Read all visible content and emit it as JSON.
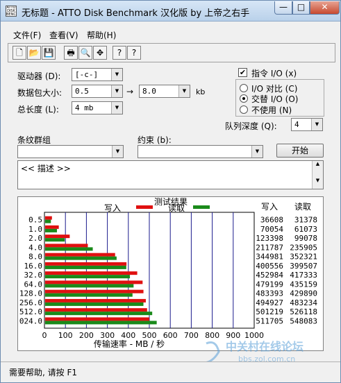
{
  "window": {
    "title": "无标题 - ATTO Disk Benchmark  汉化版 by 上帝之右手",
    "icon_label": "ATTO DISK BENCH",
    "minimize_glyph": "—",
    "maximize_glyph": "□",
    "close_glyph": "✕"
  },
  "menu": [
    "文件(F)",
    "查看(V)",
    "帮助(H)"
  ],
  "toolbar": {
    "icons": [
      "new-file-icon",
      "open-folder-icon",
      "save-icon",
      "print-icon",
      "print-preview-icon",
      "move-icon",
      "help-icon",
      "context-help-icon"
    ],
    "glyphs": [
      "🗋",
      "📂",
      "💾",
      "🖶",
      "🔍",
      "✥",
      "?",
      "?"
    ]
  },
  "settings": {
    "drive_label": "驱动器 (D):",
    "drive_value": "[-c-]",
    "size_label": "数据包大小:",
    "size_from": "0.5",
    "size_to": "8.0",
    "size_unit": "kb",
    "arrow": "→",
    "length_label": "总长度 (L):",
    "length_value": "4 mb",
    "force_io_label": "指令 I/O (x)",
    "io_compare_label": "I/O 对比 (C)",
    "overlapped_label": "交替 I/O (O)",
    "neither_label": "不使用 (N)",
    "queue_label": "队列深度 (Q):",
    "queue_value": "4",
    "stripe_label": "条纹群组",
    "constraint_label": "约束 (b):",
    "start_button": "开始",
    "description": "<< 描述 >>",
    "dropdown_arrow": "▼",
    "scroll_up": "▲",
    "scroll_down": "▼",
    "checkmark": "✔"
  },
  "results": {
    "title": "测试结果",
    "write_legend": "写入",
    "read_legend": "读取",
    "write_col_header": "写入",
    "read_col_header": "读取",
    "write_color": "#e01010",
    "read_color": "#1a8a1a",
    "x_label": "传输速率 - MB / 秒"
  },
  "chart_data": {
    "type": "bar",
    "title": "测试结果",
    "xlabel": "传输速率 - MB / 秒",
    "xlim": [
      0,
      1000
    ],
    "x_ticks": [
      0,
      100,
      200,
      300,
      400,
      500,
      600,
      700,
      800,
      900,
      1000
    ],
    "tick_labels": [
      "0",
      "100",
      "200",
      "300",
      "400",
      "500",
      "600",
      "700",
      "800",
      "900",
      "1000"
    ],
    "categories": [
      "0.5",
      "1.0",
      "2.0",
      "4.0",
      "8.0",
      "16.0",
      "32.0",
      "64.0",
      "128.0",
      "256.0",
      "512.0",
      "024.0"
    ],
    "series": [
      {
        "name": "写入",
        "values_kbps": [
          36608,
          70054,
          123398,
          211787,
          344981,
          400556,
          452984,
          479199,
          483393,
          494927,
          501219,
          511705
        ]
      },
      {
        "name": "读取",
        "values_kbps": [
          31378,
          61073,
          99078,
          235905,
          352321,
          399507,
          417333,
          435159,
          429890,
          483234,
          526118,
          548083
        ]
      }
    ],
    "write_labels": [
      "36608",
      "70054",
      "123398",
      "211787",
      "344981",
      "400556",
      "452984",
      "479199",
      "483393",
      "494927",
      "501219",
      "511705"
    ],
    "read_labels": [
      "31378",
      "61073",
      "99078",
      "235905",
      "352321",
      "399507",
      "417333",
      "435159",
      "429890",
      "483234",
      "526118",
      "548083"
    ]
  },
  "status": {
    "text": "需要帮助, 请按 F1"
  },
  "watermark": {
    "text": "中关村在线论坛",
    "url": "bbs.zol.com.cn"
  }
}
